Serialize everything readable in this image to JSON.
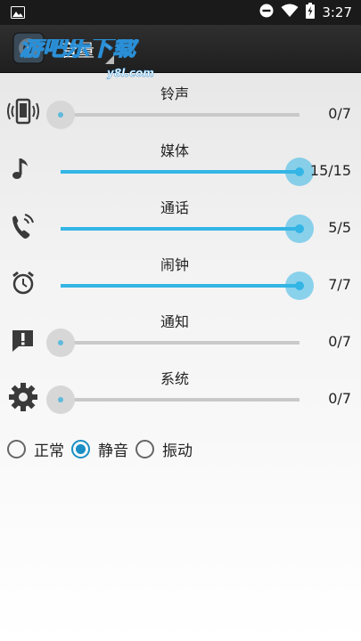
{
  "status_bar": {
    "time": "3:27",
    "icons": [
      "image-notification-icon",
      "do-not-disturb-icon",
      "wifi-icon",
      "battery-charging-icon"
    ]
  },
  "app_bar": {
    "title": "音量",
    "watermark": "游吧乐下载",
    "watermark_domain": "y8l.com"
  },
  "volume_rows": [
    {
      "label": "铃声",
      "value": "0/7",
      "level": 0,
      "icon": "ringer-vibrate-icon"
    },
    {
      "label": "媒体",
      "value": "15/15",
      "level": 1.0,
      "icon": "music-note-icon"
    },
    {
      "label": "通话",
      "value": "5/5",
      "level": 1.0,
      "icon": "phone-call-icon"
    },
    {
      "label": "闹钟",
      "value": "7/7",
      "level": 1.0,
      "icon": "alarm-clock-icon"
    },
    {
      "label": "通知",
      "value": "0/7",
      "level": 0,
      "icon": "notification-alert-icon"
    },
    {
      "label": "系统",
      "value": "0/7",
      "level": 0,
      "icon": "gear-icon"
    }
  ],
  "ring_mode": {
    "options": [
      "正常",
      "静音",
      "振动"
    ],
    "selected": "静音"
  },
  "colors": {
    "accent": "#33b5e5",
    "radio_checked": "#1a8fc5",
    "app_bar": "#262626",
    "status_bar": "#1a1a1a"
  }
}
